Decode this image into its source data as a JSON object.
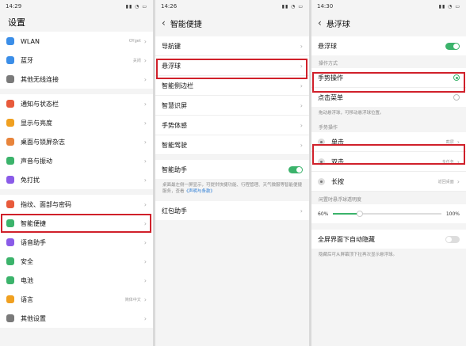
{
  "panel1": {
    "status_time": "14:29",
    "title": "设置",
    "groups": [
      [
        {
          "label": "WLAN",
          "value": "OYget",
          "icon": "wifi-icon",
          "color": "#3b8ee8"
        },
        {
          "label": "蓝牙",
          "value": "关闭",
          "icon": "bluetooth-icon",
          "color": "#3b8ee8"
        },
        {
          "label": "其他无线连接",
          "value": "",
          "icon": "link-icon",
          "color": "#7a7a7a"
        }
      ],
      [
        {
          "label": "通知与状态栏",
          "value": "",
          "icon": "notification-icon",
          "color": "#e85a3b"
        },
        {
          "label": "显示与亮度",
          "value": "",
          "icon": "brightness-icon",
          "color": "#f0a020"
        },
        {
          "label": "桌面与锁屏杂志",
          "value": "",
          "icon": "desktop-icon",
          "color": "#e8843b"
        },
        {
          "label": "声音与振动",
          "value": "",
          "icon": "sound-icon",
          "color": "#3bb36b"
        },
        {
          "label": "免打扰",
          "value": "",
          "icon": "moon-icon",
          "color": "#8a5be8"
        }
      ],
      [
        {
          "label": "指纹、面部与密码",
          "value": "",
          "icon": "fingerprint-icon",
          "color": "#e85a3b"
        },
        {
          "label": "智能便捷",
          "value": "",
          "icon": "smart-icon",
          "color": "#3bb36b"
        },
        {
          "label": "语音助手",
          "value": "",
          "icon": "mic-icon",
          "color": "#8a5be8"
        },
        {
          "label": "安全",
          "value": "",
          "icon": "shield-icon",
          "color": "#3bb36b"
        },
        {
          "label": "电池",
          "value": "",
          "icon": "battery-icon",
          "color": "#3bb36b"
        },
        {
          "label": "语言",
          "value": "简体中文",
          "icon": "language-icon",
          "color": "#f0a020"
        },
        {
          "label": "其他设置",
          "value": "",
          "icon": "gear-icon",
          "color": "#7a7a7a"
        }
      ]
    ]
  },
  "panel2": {
    "status_time": "14:26",
    "title": "智能便捷",
    "items1": [
      "导航键",
      "悬浮球",
      "智能侧边栏",
      "智慧识屏",
      "手势体感",
      "智能驾驶"
    ],
    "assistant_label": "智能助手",
    "assistant_note": "桌面最左侧一屏显示，可提供快捷功能、行程管理、天气微服等智能便捷服务，查看",
    "assistant_link": "《声明与条款》",
    "redpack_label": "红包助手"
  },
  "panel3": {
    "status_time": "14:30",
    "title": "悬浮球",
    "ball_label": "悬浮球",
    "mode_section": "操作方式",
    "gesture_label": "手势操作",
    "menu_label": "点击菜单",
    "mode_note": "拖动悬浮球，可移动悬浮球位置。",
    "gesture_section": "手势操作",
    "gestures": [
      {
        "label": "单击",
        "value": "截屏"
      },
      {
        "label": "双击",
        "value": "多任务"
      },
      {
        "label": "长按",
        "value": "返回桌面"
      }
    ],
    "opacity_section": "闲置时悬浮球透明度",
    "opacity_min": "60%",
    "opacity_max": "100%",
    "opacity_value": 0.25,
    "fullscreen_label": "全屏界面下自动隐藏",
    "fullscreen_note": "隐藏后可从屏幕顶下拉再次显示悬浮球。"
  }
}
